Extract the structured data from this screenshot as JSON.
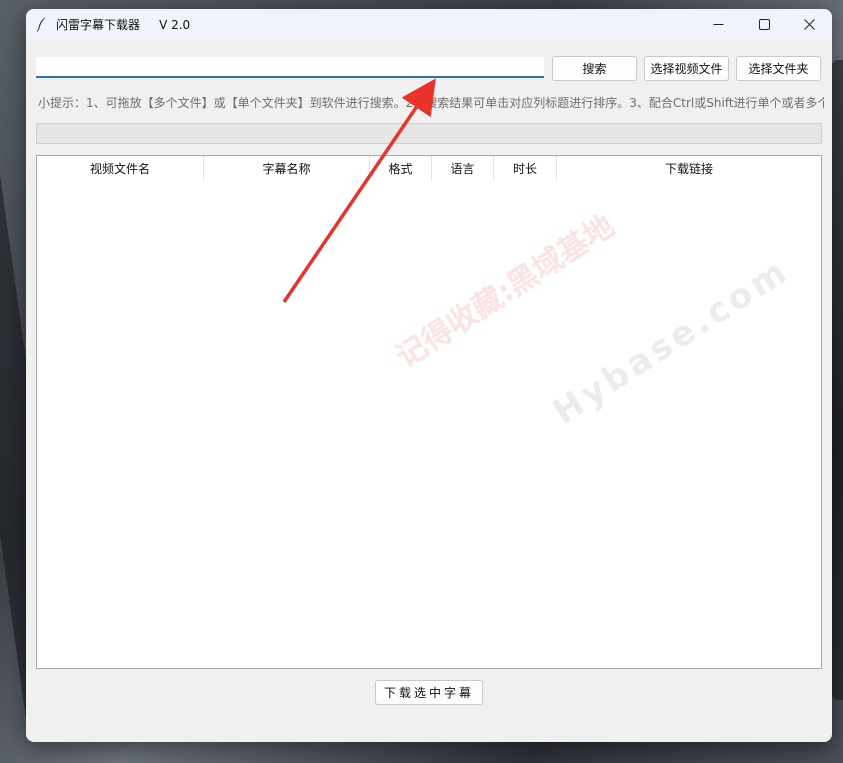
{
  "window": {
    "title": "闪雷字幕下载器     V 2.0",
    "minimize_icon": "minimize-icon",
    "maximize_icon": "maximize-icon",
    "close_icon": "close-icon"
  },
  "search": {
    "value": "",
    "button_label": "搜索",
    "select_video_label": "选择视频文件",
    "select_folder_label": "选择文件夹"
  },
  "tip": "小提示：1、可拖放【多个文件】或【单个文件夹】到软件进行搜索。2、搜索结果可单击对应列标题进行排序。3、配合Ctrl或Shift进行单个或者多个",
  "progress": {
    "value": 0
  },
  "table": {
    "columns": [
      "视频文件名",
      "字幕名称",
      "格式",
      "语言",
      "时长",
      "下载链接"
    ],
    "rows": []
  },
  "download_button_label": "下载选中字幕",
  "watermark": {
    "line1": "记得收藏:黑域基地",
    "line2": "Hybase.com"
  },
  "colors": {
    "accent": "#2f6fb5",
    "arrow": "#e8332a",
    "window_bg": "#f0f0f0"
  }
}
